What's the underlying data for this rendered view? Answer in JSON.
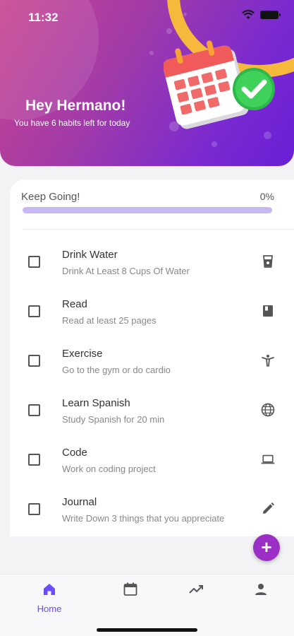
{
  "status_bar": {
    "time": "11:32"
  },
  "header": {
    "greeting": "Hey Hermano!",
    "subtitle": "You have 6 habits left for today"
  },
  "progress": {
    "label": "Keep Going!",
    "percent_text": "0%",
    "value": 0
  },
  "habits": [
    {
      "title": "Drink Water",
      "description": "Drink At Least 8 Cups Of Water",
      "icon": "cup-icon",
      "checked": false
    },
    {
      "title": "Read",
      "description": "Read at least 25 pages",
      "icon": "book-icon",
      "checked": false
    },
    {
      "title": "Exercise",
      "description": "Go to the gym or do cardio",
      "icon": "exercise-icon",
      "checked": false
    },
    {
      "title": "Learn Spanish",
      "description": "Study Spanish for 20 min",
      "icon": "globe-icon",
      "checked": false
    },
    {
      "title": "Code",
      "description": "Work on coding project",
      "icon": "laptop-icon",
      "checked": false
    },
    {
      "title": "Journal",
      "description": "Write Down 3 things that you appreciate",
      "icon": "pencil-icon",
      "checked": false
    }
  ],
  "fab": {
    "label": "+"
  },
  "bottom_nav": {
    "items": [
      {
        "label": "Home",
        "icon": "home-icon",
        "active": true
      },
      {
        "label": "",
        "icon": "calendar-icon",
        "active": false
      },
      {
        "label": "",
        "icon": "trending-icon",
        "active": false
      },
      {
        "label": "",
        "icon": "person-icon",
        "active": false
      }
    ]
  },
  "colors": {
    "accent": "#6b4cf6",
    "progress_track": "#c9b7f3",
    "fab": "#9b2fc5",
    "header_gradient_start": "#c8428f",
    "header_gradient_end": "#6a1fd6"
  }
}
